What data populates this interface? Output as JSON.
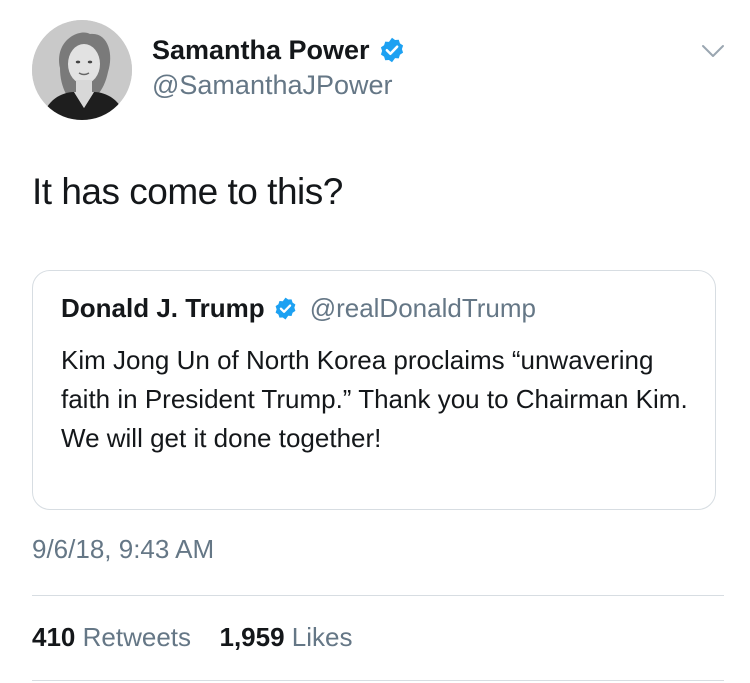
{
  "tweet": {
    "author": {
      "display_name": "Samantha Power",
      "handle": "@SamanthaJPower",
      "verified": true
    },
    "text": "It has come to this?",
    "quoted_tweet": {
      "author": {
        "display_name": "Donald J. Trump",
        "handle": "@realDonaldTrump",
        "verified": true
      },
      "text": "Kim Jong Un of North Korea proclaims “unwavering faith in President Trump.” Thank you to Chairman Kim. We will get it done together!"
    },
    "timestamp": "9/6/18, 9:43 AM",
    "stats": {
      "retweets_count": "410",
      "retweets_label": "Retweets",
      "likes_count": "1,959",
      "likes_label": "Likes"
    }
  },
  "icons": {
    "verified": "verified-badge-icon",
    "menu": "chevron-down-icon"
  },
  "colors": {
    "verified_blue": "#1da1f2",
    "text_primary": "#14171a",
    "text_secondary": "#657786",
    "border": "#d7dde2"
  }
}
